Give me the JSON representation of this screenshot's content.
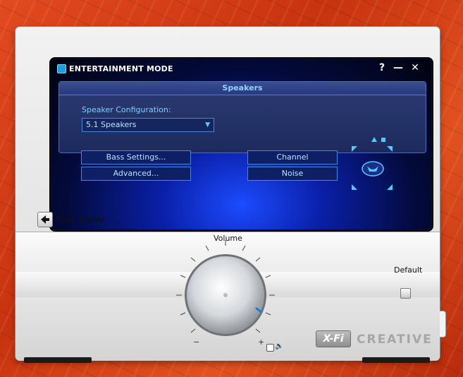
{
  "window": {
    "title": "ENTERTAINMENT MODE",
    "help": "?",
    "minimize": "—",
    "close": "✕"
  },
  "panel": {
    "header": "Speakers",
    "config_label": "Speaker Configuration:",
    "config_value": "5.1 Speakers",
    "buttons": {
      "bass": "Bass Settings...",
      "advanced": "Advanced...",
      "channel": "Channel",
      "noise": "Noise"
    }
  },
  "nav": {
    "main_display": "Main Display"
  },
  "volume": {
    "label": "Volume",
    "min": "−",
    "max": "+"
  },
  "default": {
    "label": "Default"
  },
  "brand": {
    "xfi": "X-Fi",
    "creative": "CREATIVE"
  },
  "colors": {
    "accent": "#5fc8ff",
    "panel_bg": "#1c2a5d",
    "screen_glow": "#1c4bff",
    "wallpaper": "#e24a1f"
  }
}
